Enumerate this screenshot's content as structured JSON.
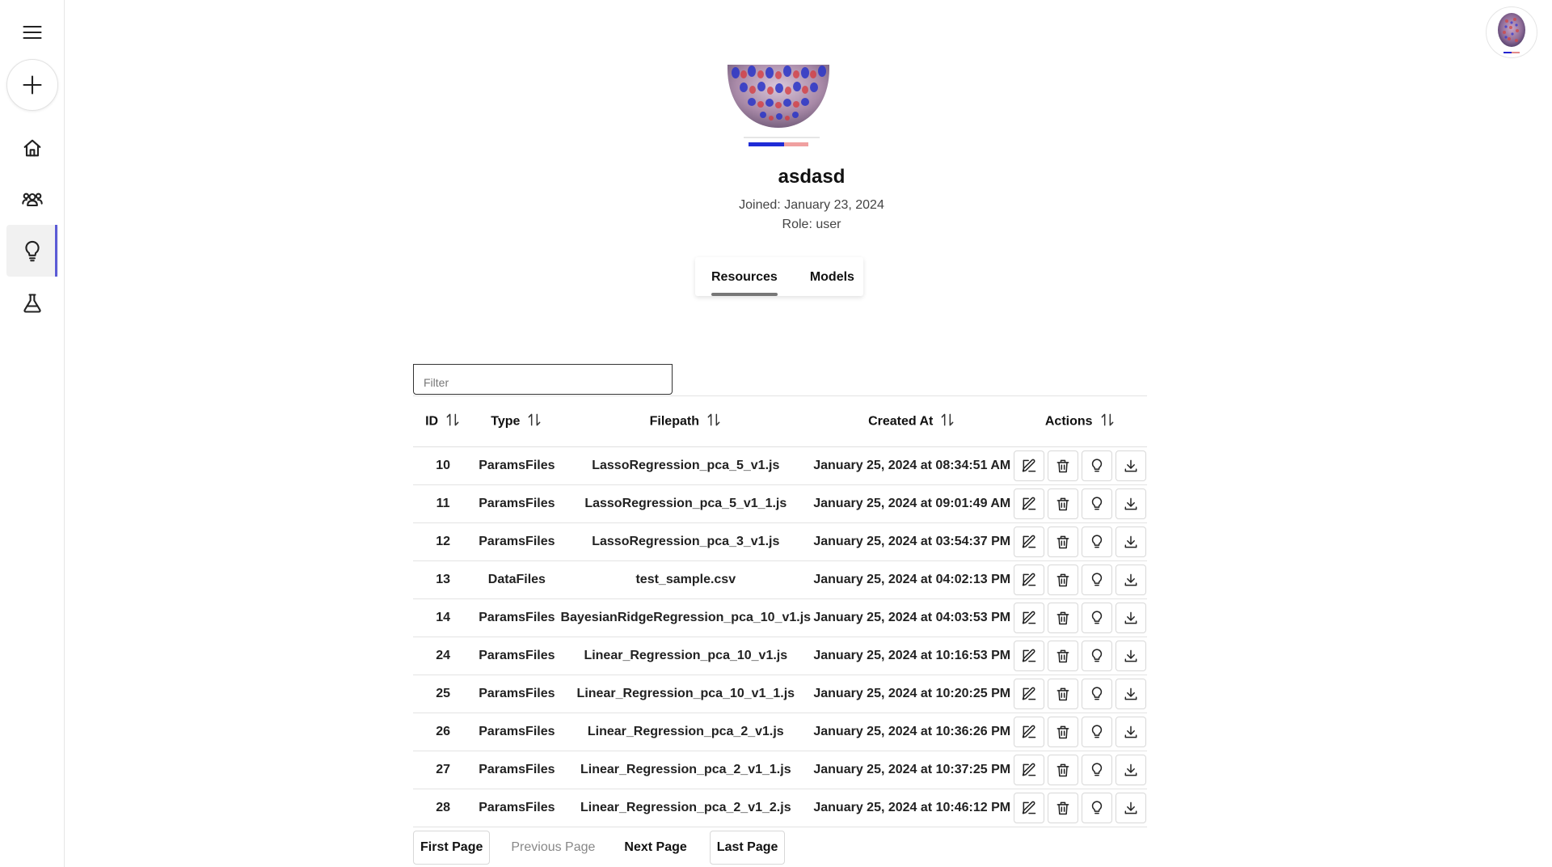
{
  "sidebar": {
    "items": [
      {
        "name": "menu-icon"
      },
      {
        "name": "plus-icon"
      },
      {
        "name": "home-icon"
      },
      {
        "name": "users-icon"
      },
      {
        "name": "lightbulb-icon",
        "active": true
      },
      {
        "name": "flask-icon"
      }
    ],
    "accent": "#5b5bd6"
  },
  "profile": {
    "username": "asdasd",
    "joined": "Joined: January 23, 2024",
    "role": "Role: user"
  },
  "tabs": [
    {
      "label": "Resources",
      "active": true
    },
    {
      "label": "Models",
      "active": false
    }
  ],
  "filter": {
    "placeholder": "Filter",
    "value": ""
  },
  "table": {
    "columns": [
      "ID",
      "Type",
      "Filepath",
      "Created At",
      "Actions"
    ],
    "rows": [
      {
        "id": "10",
        "type": "ParamsFiles",
        "filepath": "LassoRegression_pca_5_v1.js",
        "created": "January 25, 2024 at 08:34:51 AM"
      },
      {
        "id": "11",
        "type": "ParamsFiles",
        "filepath": "LassoRegression_pca_5_v1_1.js",
        "created": "January 25, 2024 at 09:01:49 AM"
      },
      {
        "id": "12",
        "type": "ParamsFiles",
        "filepath": "LassoRegression_pca_3_v1.js",
        "created": "January 25, 2024 at 03:54:37 PM"
      },
      {
        "id": "13",
        "type": "DataFiles",
        "filepath": "test_sample.csv",
        "created": "January 25, 2024 at 04:02:13 PM"
      },
      {
        "id": "14",
        "type": "ParamsFiles",
        "filepath": "BayesianRidgeRegression_pca_10_v1.js",
        "created": "January 25, 2024 at 04:03:53 PM"
      },
      {
        "id": "24",
        "type": "ParamsFiles",
        "filepath": "Linear_Regression_pca_10_v1.js",
        "created": "January 25, 2024 at 10:16:53 PM"
      },
      {
        "id": "25",
        "type": "ParamsFiles",
        "filepath": "Linear_Regression_pca_10_v1_1.js",
        "created": "January 25, 2024 at 10:20:25 PM"
      },
      {
        "id": "26",
        "type": "ParamsFiles",
        "filepath": "Linear_Regression_pca_2_v1.js",
        "created": "January 25, 2024 at 10:36:26 PM"
      },
      {
        "id": "27",
        "type": "ParamsFiles",
        "filepath": "Linear_Regression_pca_2_v1_1.js",
        "created": "January 25, 2024 at 10:37:25 PM"
      },
      {
        "id": "28",
        "type": "ParamsFiles",
        "filepath": "Linear_Regression_pca_2_v1_2.js",
        "created": "January 25, 2024 at 10:46:12 PM"
      }
    ],
    "row_actions": [
      "edit-icon",
      "trash-icon",
      "lightbulb-icon",
      "download-icon"
    ]
  },
  "pagination": {
    "first": "First Page",
    "previous": "Previous Page",
    "next": "Next Page",
    "last": "Last Page"
  }
}
